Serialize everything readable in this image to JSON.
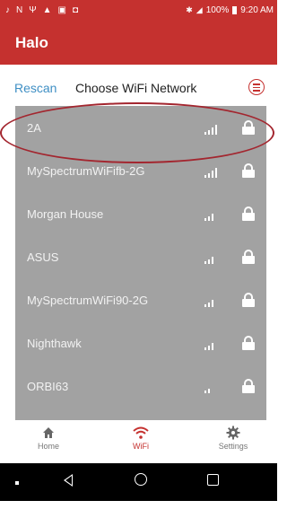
{
  "status_bar": {
    "notification_icons": [
      "tiktok-icon",
      "n-icon",
      "usb-icon",
      "warning-icon",
      "image-icon",
      "notification-icon"
    ],
    "battery": "100%",
    "time": "9:20 AM"
  },
  "app_bar": {
    "title": "Halo"
  },
  "sub_bar": {
    "rescan_label": "Rescan",
    "heading": "Choose WiFi Network"
  },
  "networks": [
    {
      "name": "2A",
      "signal_bars": 4,
      "locked": true
    },
    {
      "name": "MySpectrumWiFifb-2G",
      "signal_bars": 4,
      "locked": true
    },
    {
      "name": "Morgan House",
      "signal_bars": 3,
      "locked": true
    },
    {
      "name": "ASUS",
      "signal_bars": 3,
      "locked": true
    },
    {
      "name": "MySpectrumWiFi90-2G",
      "signal_bars": 3,
      "locked": true
    },
    {
      "name": "Nighthawk",
      "signal_bars": 3,
      "locked": true
    },
    {
      "name": "ORBI63",
      "signal_bars": 2,
      "locked": true
    }
  ],
  "tabs": [
    {
      "label": "Home",
      "icon": "home-icon"
    },
    {
      "label": "WiFi",
      "icon": "wifi-icon",
      "active": true
    },
    {
      "label": "Settings",
      "icon": "gear-icon"
    }
  ],
  "colors": {
    "brand": "#c5312f",
    "link": "#3f8fc4",
    "list_bg": "#a2a2a2",
    "annotation": "#a3262f"
  }
}
